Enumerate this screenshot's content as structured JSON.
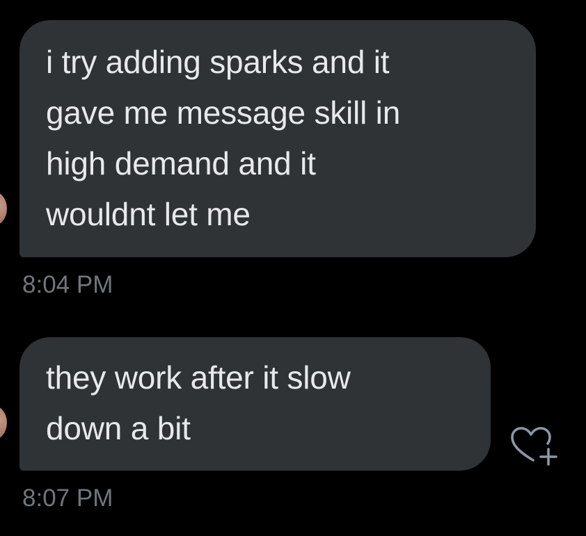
{
  "conversation": {
    "messages": [
      {
        "lines": [
          "i try adding sparks and it",
          "gave me message skill in",
          "high demand and it",
          "wouldnt let me"
        ],
        "time": "8:04 PM"
      },
      {
        "lines": [
          "they work after it slow",
          "down a bit"
        ],
        "time": "8:07 PM"
      }
    ]
  },
  "icons": {
    "reaction": "heart-plus-icon",
    "avatar": "avatar"
  },
  "colors": {
    "background": "#000000",
    "bubble": "#2f3336",
    "message_text": "#e7e9ea",
    "timestamp_text": "#71767b",
    "icon": "#8b98a5"
  }
}
